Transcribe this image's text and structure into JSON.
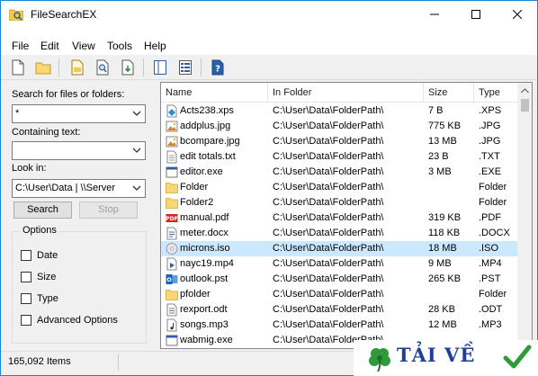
{
  "window": {
    "title": "FileSearchEX"
  },
  "menu": [
    "File",
    "Edit",
    "View",
    "Tools",
    "Help"
  ],
  "toolbar": {
    "buttons": [
      {
        "name": "new-search-button",
        "icon": "blank-page-icon"
      },
      {
        "name": "open-folder-button",
        "icon": "folder-icon"
      },
      {
        "name": "open-file-button",
        "icon": "open-file-icon"
      },
      {
        "name": "find-in-file-button",
        "icon": "magnifier-page-icon"
      },
      {
        "name": "export-button",
        "icon": "export-page-icon"
      },
      {
        "name": "toggle-panel-button",
        "icon": "panel-icon"
      },
      {
        "name": "view-details-button",
        "icon": "grid-icon"
      },
      {
        "name": "help-button",
        "icon": "help-icon"
      }
    ]
  },
  "search": {
    "files_label": "Search for files or folders:",
    "files_value": "*",
    "text_label": "Containing text:",
    "text_value": "",
    "lookin_label": "Look in:",
    "lookin_value": "C:\\User\\Data | \\\\Server",
    "search_btn": "Search",
    "stop_btn": "Stop"
  },
  "options": {
    "title": "Options",
    "items": [
      "Date",
      "Size",
      "Type",
      "Advanced Options"
    ]
  },
  "list": {
    "columns": [
      "Name",
      "In Folder",
      "Size",
      "Type"
    ],
    "rows": [
      {
        "name": "Acts238.xps",
        "folder": "C:\\User\\Data\\FolderPath\\",
        "size": "7 B",
        "type": ".XPS",
        "icon": "xps-file-icon"
      },
      {
        "name": "addplus.jpg",
        "folder": "C:\\User\\Data\\FolderPath\\",
        "size": "775 KB",
        "type": ".JPG",
        "icon": "image-file-icon"
      },
      {
        "name": "bcompare.jpg",
        "folder": "C:\\User\\Data\\FolderPath\\",
        "size": "13 MB",
        "type": ".JPG",
        "icon": "image-file-icon"
      },
      {
        "name": "edit totals.txt",
        "folder": "C:\\User\\Data\\FolderPath\\",
        "size": "23 B",
        "type": ".TXT",
        "icon": "text-file-icon"
      },
      {
        "name": "editor.exe",
        "folder": "C:\\User\\Data\\FolderPath\\",
        "size": "3 MB",
        "type": ".EXE",
        "icon": "exe-file-icon"
      },
      {
        "name": "Folder",
        "folder": "C:\\User\\Data\\FolderPath\\",
        "size": "",
        "type": "Folder",
        "icon": "folder-icon"
      },
      {
        "name": "Folder2",
        "folder": "C:\\User\\Data\\FolderPath\\",
        "size": "",
        "type": "Folder",
        "icon": "folder-icon"
      },
      {
        "name": "manual.pdf",
        "folder": "C:\\User\\Data\\FolderPath\\",
        "size": "319 KB",
        "type": ".PDF",
        "icon": "pdf-file-icon"
      },
      {
        "name": "meter.docx",
        "folder": "C:\\User\\Data\\FolderPath\\",
        "size": "118 KB",
        "type": ".DOCX",
        "icon": "doc-file-icon"
      },
      {
        "name": "microns.iso",
        "folder": "C:\\User\\Data\\FolderPath\\",
        "size": "18 MB",
        "type": ".ISO",
        "icon": "disc-file-icon"
      },
      {
        "name": "nayc19.mp4",
        "folder": "C:\\User\\Data\\FolderPath\\",
        "size": "9 MB",
        "type": ".MP4",
        "icon": "video-file-icon"
      },
      {
        "name": "outlook.pst",
        "folder": "C:\\User\\Data\\FolderPath\\",
        "size": "265 KB",
        "type": ".PST",
        "icon": "outlook-file-icon"
      },
      {
        "name": "pfolder",
        "folder": "C:\\User\\Data\\FolderPath\\",
        "size": "",
        "type": "Folder",
        "icon": "folder-icon"
      },
      {
        "name": "rexport.odt",
        "folder": "C:\\User\\Data\\FolderPath\\",
        "size": "28 KB",
        "type": ".ODT",
        "icon": "odt-file-icon"
      },
      {
        "name": "songs.mp3",
        "folder": "C:\\User\\Data\\FolderPath\\",
        "size": "12 MB",
        "type": ".MP3",
        "icon": "audio-file-icon"
      },
      {
        "name": "wabmig.exe",
        "folder": "C:\\User\\Data\\FolderPath\\",
        "size": "",
        "type": "",
        "icon": "exe-file-icon"
      }
    ],
    "selected_index": 9
  },
  "status": {
    "items": "165,092 Items"
  },
  "watermark": {
    "text": "TẢI VỀ"
  },
  "colors": {
    "accent": "#1883d7",
    "selection": "#cce8ff",
    "folder": "#f8d775"
  }
}
